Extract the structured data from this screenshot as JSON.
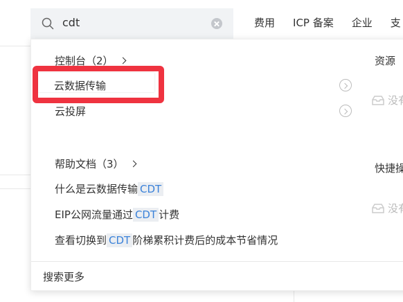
{
  "search": {
    "query": "cdt"
  },
  "top_nav": [
    "费用",
    "ICP 备案",
    "企业",
    "支"
  ],
  "dropdown": {
    "console_section": {
      "title": "控制台（2）",
      "items": [
        "云数据传输",
        "云投屏"
      ]
    },
    "help_section": {
      "title": "帮助文档（3）",
      "items": [
        {
          "before": "什么是云数据传输",
          "keyword": "CDT",
          "after": ""
        },
        {
          "before": "EIP公网流量通过",
          "keyword": "CDT",
          "after": "计费"
        },
        {
          "before": "查看切换到",
          "keyword": "CDT",
          "after": "阶梯累积计费后的成本节省情况"
        }
      ]
    },
    "right_column": {
      "resources_title": "资源",
      "shortcuts_title": "快捷操",
      "empty_text": "没有"
    },
    "search_more": "搜索更多"
  },
  "colors": {
    "highlight_border": "#ef3340",
    "keyword": "#3b82d9",
    "keyword_bg": "#ebeef2"
  }
}
